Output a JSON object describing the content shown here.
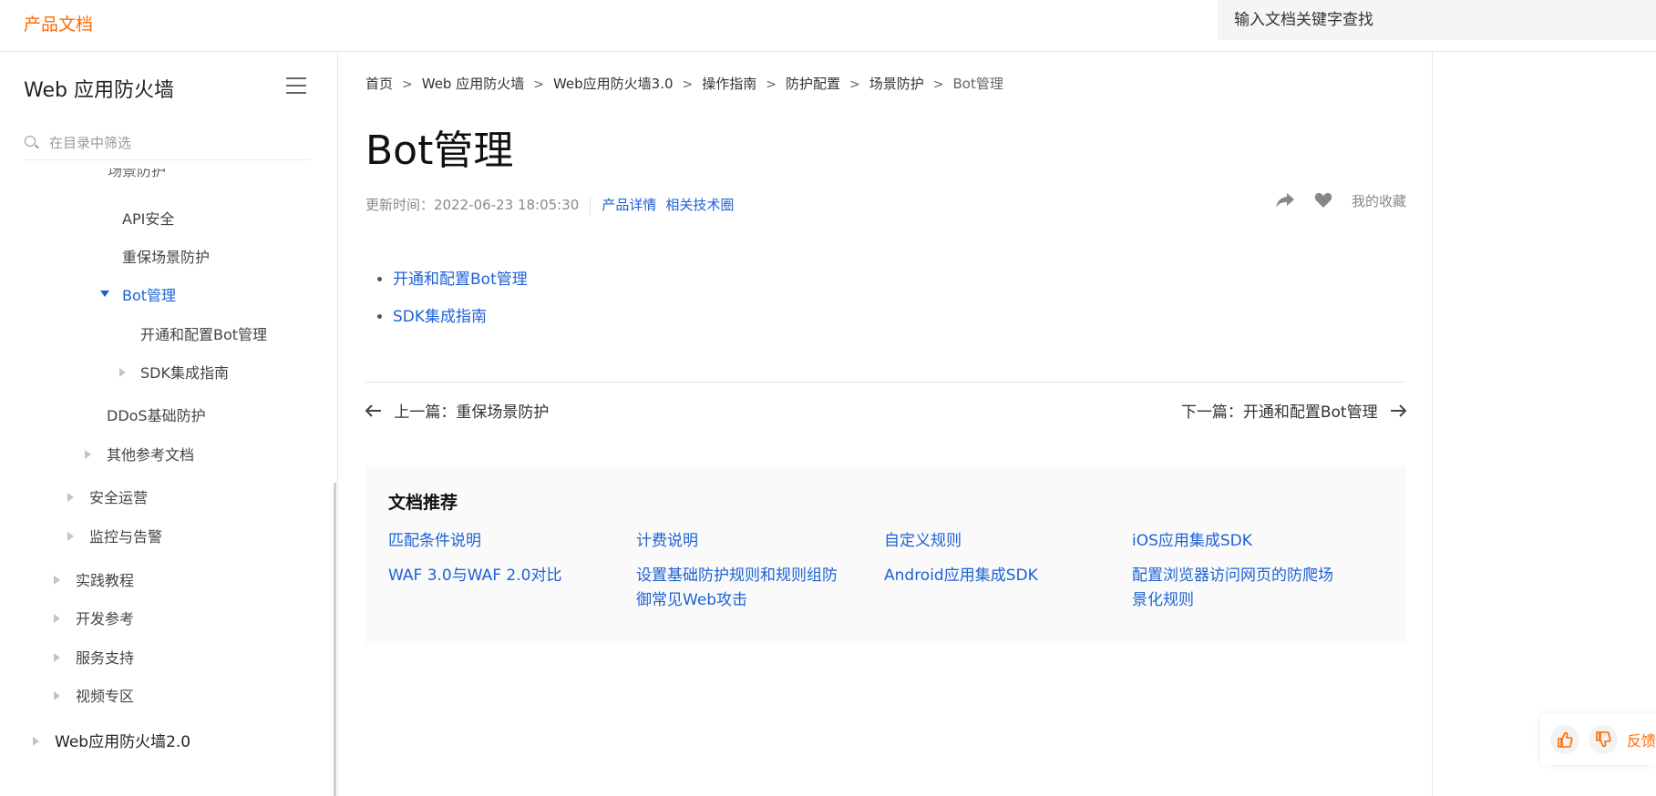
{
  "header": {
    "brand": "产品文档",
    "search_placeholder": "输入文档关键字查找"
  },
  "sidebar": {
    "title": "Web 应用防火墙",
    "filter_placeholder": "在目录中筛选",
    "items": [
      {
        "label": "API安全"
      },
      {
        "label": "重保场景防护"
      },
      {
        "label": "Bot管理"
      },
      {
        "label": "开通和配置Bot管理"
      },
      {
        "label": "SDK集成指南"
      },
      {
        "label": "DDoS基础防护"
      },
      {
        "label": "其他参考文档"
      },
      {
        "label": "安全运营"
      },
      {
        "label": "监控与告警"
      },
      {
        "label": "实践教程"
      },
      {
        "label": "开发参考"
      },
      {
        "label": "服务支持"
      },
      {
        "label": "视频专区"
      },
      {
        "label": "Web应用防火墙2.0"
      }
    ],
    "cut_label": "场景防护"
  },
  "breadcrumb": [
    "首页",
    "Web 应用防火墙",
    "Web应用防火墙3.0",
    "操作指南",
    "防护配置",
    "场景防护",
    "Bot管理"
  ],
  "article": {
    "title": "Bot管理",
    "updated": "更新时间：2022-06-23 18:05:30",
    "product_detail": "产品详情",
    "tech_circle": "相关技术圈",
    "favorites": "我的收藏",
    "toc": [
      "开通和配置Bot管理",
      "SDK集成指南"
    ],
    "prev": "上一篇：重保场景防护",
    "next": "下一篇：开通和配置Bot管理"
  },
  "recommend": {
    "title": "文档推荐",
    "links": [
      "匹配条件说明",
      "计费说明",
      "自定义规则",
      "iOS应用集成SDK",
      "WAF 3.0与WAF 2.0对比",
      "设置基础防护规则和规则组防御常见Web攻击",
      "Android应用集成SDK",
      "配置浏览器访问网页的防爬场景化规则"
    ]
  },
  "feedback": {
    "label": "反馈"
  },
  "colors": {
    "brand": "#ff6a00",
    "link": "#1d62d4"
  }
}
